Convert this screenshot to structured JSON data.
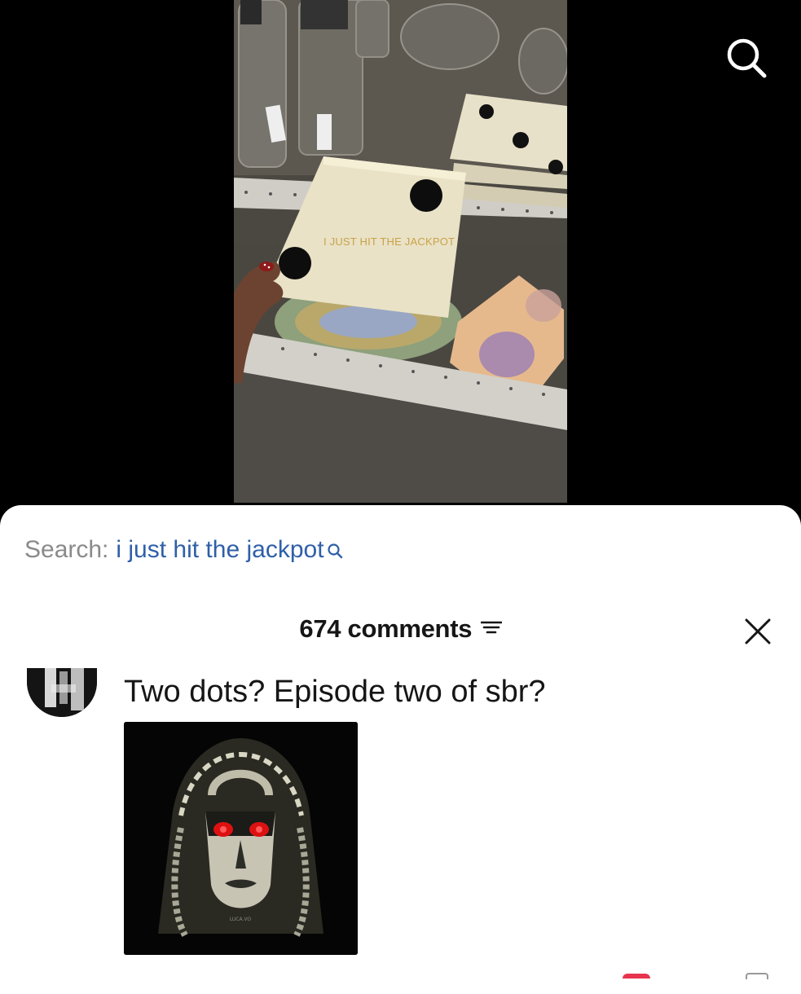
{
  "video": {
    "overlay_text": "I JUST HIT THE JACKPOT"
  },
  "top_bar": {
    "search_icon": "search-icon"
  },
  "sheet": {
    "search_prefix": "Search:",
    "search_query": "i just hit the jackpot",
    "comments_count": "674 comments",
    "sort_icon": "sort-icon",
    "close_icon": "close-icon"
  },
  "comment": {
    "text": "Two dots? Episode two of sbr?",
    "image_watermark": "LUCA.VO"
  },
  "colors": {
    "search_query": "#2f5fa8",
    "search_prefix": "#8a8a8a",
    "overlay_text": "#c9a24a",
    "like": "#e8344e"
  }
}
